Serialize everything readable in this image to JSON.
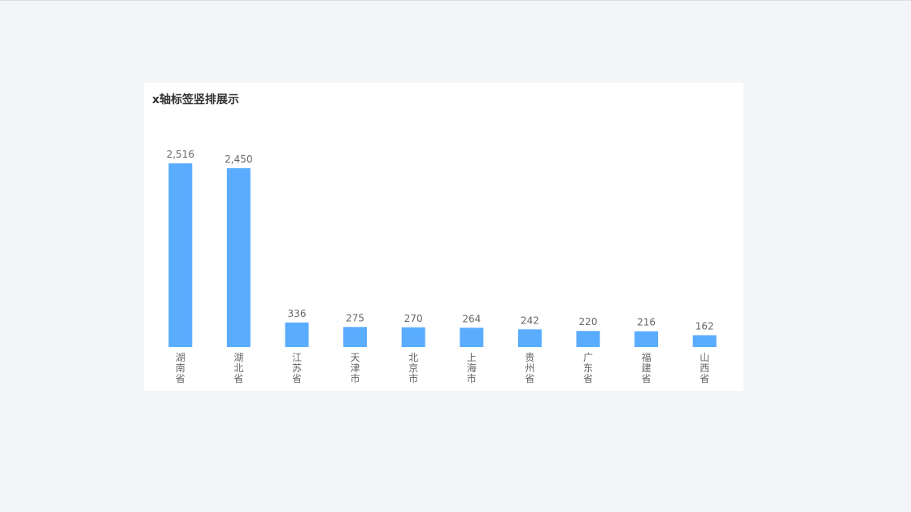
{
  "page": {
    "background": "#f4f5f9"
  },
  "card": {
    "title": "x轴标签竖排展示"
  },
  "chart_data": {
    "type": "bar",
    "title": "x轴标签竖排展示",
    "categories": [
      "湖南省",
      "湖北省",
      "江苏省",
      "天津市",
      "北京市",
      "上海市",
      "贵州省",
      "广东省",
      "福建省",
      "山西省"
    ],
    "values": [
      2516,
      2450,
      336,
      275,
      270,
      264,
      242,
      220,
      216,
      162
    ],
    "value_labels": [
      "2,516",
      "2,450",
      "336",
      "275",
      "270",
      "264",
      "242",
      "220",
      "216",
      "162"
    ],
    "xlabel": "",
    "ylabel": "",
    "ylim": [
      0,
      2516
    ],
    "x_label_orientation": "vertical",
    "grid": false,
    "color": "#5aacff"
  }
}
